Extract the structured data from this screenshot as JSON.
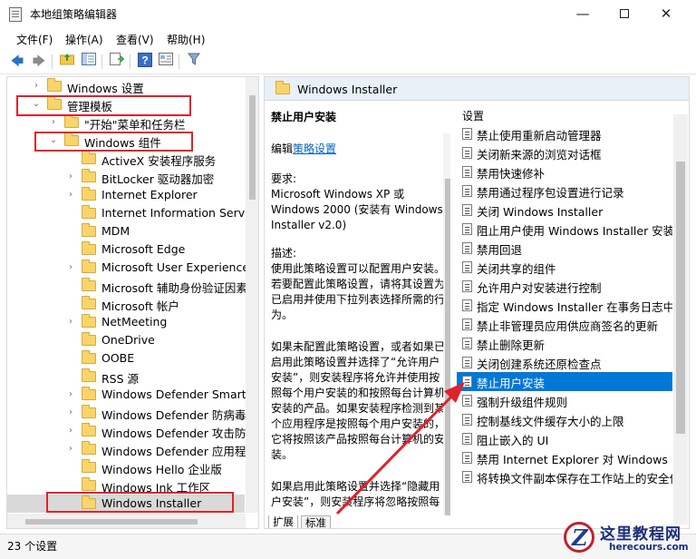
{
  "window": {
    "title": "本地组策略编辑器",
    "minimize": "—",
    "close": "✕"
  },
  "menu": [
    "文件(F)",
    "操作(A)",
    "查看(V)",
    "帮助(H)"
  ],
  "tree": {
    "items": [
      {
        "label": "Windows 设置",
        "expander": "›"
      },
      {
        "label": "管理模板",
        "expander": "⌄"
      },
      {
        "label": "\"开始\"菜单和任务栏",
        "expander": "›"
      },
      {
        "label": "Windows 组件",
        "expander": "⌄"
      },
      {
        "label": "ActiveX 安装程序服务",
        "expander": ""
      },
      {
        "label": "BitLocker 驱动器加密",
        "expander": "›"
      },
      {
        "label": "Internet Explorer",
        "expander": "›"
      },
      {
        "label": "Internet Information Service",
        "expander": ""
      },
      {
        "label": "MDM",
        "expander": ""
      },
      {
        "label": "Microsoft Edge",
        "expander": ""
      },
      {
        "label": "Microsoft User Experience V",
        "expander": "›"
      },
      {
        "label": "Microsoft 辅助身份验证因素",
        "expander": ""
      },
      {
        "label": "Microsoft 帐户",
        "expander": ""
      },
      {
        "label": "NetMeeting",
        "expander": "›"
      },
      {
        "label": "OneDrive",
        "expander": ""
      },
      {
        "label": "OOBE",
        "expander": ""
      },
      {
        "label": "RSS 源",
        "expander": ""
      },
      {
        "label": "Windows Defender SmartSc",
        "expander": "›"
      },
      {
        "label": "Windows Defender 防病毒程",
        "expander": "›"
      },
      {
        "label": "Windows Defender 攻击防护",
        "expander": "›"
      },
      {
        "label": "Windows Defender 应用程序",
        "expander": "›"
      },
      {
        "label": "Windows Hello 企业版",
        "expander": ""
      },
      {
        "label": "Windows Ink 工作区",
        "expander": ""
      },
      {
        "label": "Windows Installer",
        "expander": ""
      }
    ]
  },
  "right": {
    "header_title": "Windows Installer",
    "description": {
      "heading": "禁止用户安装",
      "edit_prefix": "编辑",
      "edit_link": "策略设置",
      "requirements_label": "要求:",
      "requirements": "Microsoft Windows XP 或 Windows 2000 (安装有 Windows Installer v2.0)",
      "desc_label": "描述:",
      "desc_p1": "使用此策略设置可以配置用户安装。若要配置此策略设置，请将其设置为已启用并使用下拉列表选择所需的行为。",
      "desc_p2": "如果未配置此策略设置，或者如果已启用此策略设置并选择了“允许用户安装”，则安装程序将允许并使用按照每个用户安装的和按照每台计算机安装的产品。如果安装程序检测到某个应用程序是按照每个用户安装的，它将按照该产品按照每台计算机的安装。",
      "desc_p3": "如果启用此策略设置并选择“隐藏用户安装”，则安装程序将忽略按照每"
    },
    "settings_header": "设置",
    "settings": [
      "禁止使用重新启动管理器",
      "关闭新来源的浏览对话框",
      "禁用快速修补",
      "禁用通过程序包设置进行记录",
      "关闭 Windows Installer",
      "阻止用户使用 Windows Installer 安装更",
      "禁用回退",
      "关闭共享的组件",
      "允许用户对安装进行控制",
      "指定 Windows Installer 在事务日志中记",
      "禁止非管理员应用供应商签名的更新",
      "禁止删除更新",
      "关闭创建系统还原检查点",
      "禁止用户安装",
      "强制升级组件规则",
      "控制基线文件缓存大小的上限",
      "阻止嵌入的 UI",
      "禁用 Internet Explorer 对 Windows In",
      "将转换文件副本保存在工作站上的安全位"
    ],
    "selected_index": 13,
    "tabs": [
      "扩展",
      "标准"
    ]
  },
  "status": "23 个设置",
  "watermark": {
    "logo": "Z",
    "title": "这里教程网",
    "url": "herecours.com"
  },
  "colors": {
    "selection": "#0078d7",
    "highlight_box": "#e0222a",
    "link": "#0563c1"
  }
}
